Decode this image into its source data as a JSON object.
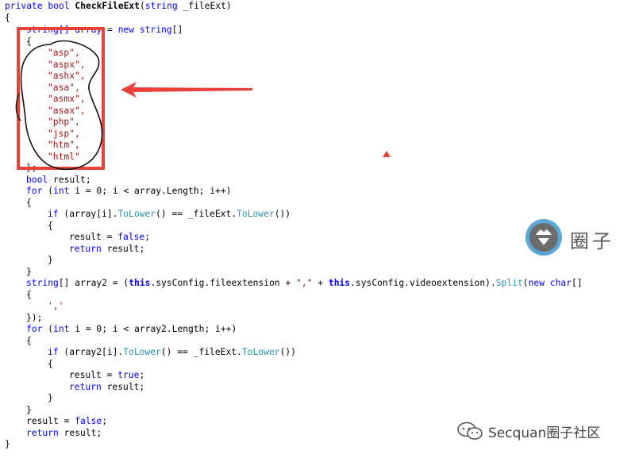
{
  "code": {
    "method_header": {
      "modifiers": "private bool ",
      "name": "CheckFileExt",
      "open": "(",
      "param_type": "string",
      "param_rest": " _fileExt)"
    },
    "brace_open": "{",
    "array_decl": {
      "prefix": "string[] array",
      "assign": " = ",
      "new_kw": "new",
      "type": " string",
      "suffix": "[]"
    },
    "array_open": "{",
    "extensions": [
      "\"asp\",",
      "\"aspx\",",
      "\"ashx\",",
      "\"asa\",",
      "\"asmx\",",
      "\"asax\",",
      "\"php\",",
      "\"jsp\",",
      "\"htm\",",
      "\"html\""
    ],
    "array_close": "};",
    "result_decl": {
      "kw": "bool",
      "rest": " result;"
    },
    "for1": {
      "kw": "for",
      "open": " (",
      "int_kw": "int",
      "rest": " i = 0; i < array.Length; i++)"
    },
    "for1_open": "{",
    "if1": {
      "kw": "if",
      "pre": " (array[i].",
      "m1": "ToLower",
      "mid": "() == _fileExt.",
      "m2": "ToLower",
      "post": "())"
    },
    "if1_open": "{",
    "assign_false": {
      "pre": "result = ",
      "kw": "false",
      "post": ";"
    },
    "return1": {
      "kw": "return",
      "rest": " result;"
    },
    "if1_close": "}",
    "for1_close": "}",
    "array2_decl": {
      "type": "string",
      "pre": "[] array2 = (",
      "this1": "this",
      "mid1": ".sysConfig.fileextension + ",
      "sep": "\",\"",
      "mid2": " + ",
      "this2": "this",
      "mid3": ".sysConfig.videoextension).",
      "split": "Split",
      "open": "(",
      "new_kw": "new",
      "char_kw": " char",
      "close": "[]"
    },
    "array2_open": "{",
    "comma_char": "','",
    "array2_close": "});",
    "for2": {
      "kw": "for",
      "open": " (",
      "int_kw": "int",
      "rest": " i = 0; i < array2.Length; i++)"
    },
    "for2_open": "{",
    "if2": {
      "kw": "if",
      "pre": " (array2[i].",
      "m1": "ToLower",
      "mid": "() == _fileExt.",
      "m2": "ToLower",
      "post": "())"
    },
    "if2_open": "{",
    "assign_true": {
      "pre": "result = ",
      "kw": "true",
      "post": ";"
    },
    "return2": {
      "kw": "return",
      "rest": " result;"
    },
    "if2_close": "}",
    "for2_close": "}",
    "assign_false2": {
      "pre": "result = ",
      "kw": "false",
      "post": ";"
    },
    "return3": {
      "kw": "return",
      "rest": " result;"
    },
    "brace_close": "}"
  },
  "watermark": {
    "brand": "圈子",
    "footer": "Secquan圈子社区",
    "icon": "hat-person-icon"
  },
  "colors": {
    "keyword": "#0000ff",
    "type": "#2b91af",
    "string": "#a31515",
    "annotation": "#e8413a"
  }
}
